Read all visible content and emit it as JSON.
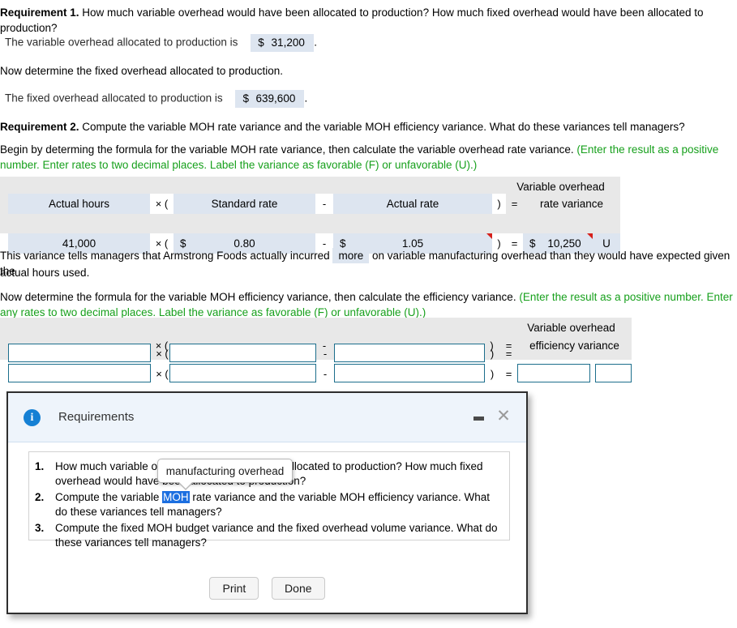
{
  "req1": {
    "label": "Requirement 1.",
    "question": "How much variable overhead would have been allocated to production? How much fixed overhead would have been allocated to production?",
    "line1_prefix": "The variable overhead allocated to production is",
    "line1_currency": "$",
    "line1_value": "31,200",
    "line1_suffix": ".",
    "line2": "Now determine the fixed overhead allocated to production.",
    "line3_prefix": "The fixed overhead allocated to production is",
    "line3_currency": "$",
    "line3_value": "639,600",
    "line3_suffix": "."
  },
  "req2": {
    "label": "Requirement 2.",
    "question": "Compute the variable MOH rate variance and the variable MOH efficiency variance. What do these variances tell managers?",
    "instruction_black": "Begin by determing the formula for the variable MOH rate variance, then calculate the variable overhead rate variance.",
    "instruction_green": "(Enter the result as a positive number. Enter rates to two decimal places. Label the variance as favorable (F) or unfavorable (U).)"
  },
  "rate_table": {
    "header_top_right": "Variable overhead",
    "headers": {
      "col1": "Actual hours",
      "op1": "× (",
      "col2": "Standard rate",
      "op2": "-",
      "col3": "Actual rate",
      "op3": ")",
      "eq": "=",
      "result": "rate variance"
    },
    "values": {
      "col1": "41,000",
      "op1": "× (",
      "col2_currency": "$",
      "col2": "0.80",
      "op2": "-",
      "col3_currency": "$",
      "col3": "1.05",
      "op3": ")",
      "eq": "=",
      "result_currency": "$",
      "result": "10,250",
      "flag": "U"
    }
  },
  "narrative": {
    "prefix": "This variance tells managers that Armstrong Foods actually incurred",
    "dropdown_value": "more",
    "suffix": "on variable manufacturing overhead than they would have expected given the",
    "line2": "actual hours used."
  },
  "req2b": {
    "instruction_black": "Now determine the formula for the variable MOH efficiency variance, then calculate the efficiency variance.",
    "instruction_green": "(Enter the result as a positive number. Enter any rates to two decimal places. Label the variance as favorable (F) or unfavorable (U).)"
  },
  "efficiency_table": {
    "header_top_right": "Variable overhead",
    "headers": {
      "op1": "× (",
      "op2": "-",
      "op3": ")",
      "eq": "=",
      "result": "efficiency variance"
    },
    "values": {
      "op1": "× (",
      "op2": "-",
      "op3": ")",
      "eq": "="
    },
    "inputs": {
      "r1c1": "",
      "r1c2": "",
      "r1c3": "",
      "r2c1": "",
      "r2c2": "",
      "r2c3": "",
      "r2result": "",
      "r2flag": ""
    },
    "placeholder": ""
  },
  "dialog": {
    "title": "Requirements",
    "info_icon": "info-icon",
    "minimize_icon": "minimize-icon",
    "close_icon": "close-icon",
    "items": [
      {
        "num": "1.",
        "text": "How much variable overhead would have been allocated to production? How much fixed overhead would have been allocated to production?"
      },
      {
        "num": "2.",
        "pre": "Compute the variable ",
        "sel": "MOH",
        "post": " rate variance and the variable MOH efficiency variance. What do these variances tell managers?"
      },
      {
        "num": "3.",
        "text": "Compute the fixed MOH budget variance and the fixed overhead volume variance. What do these variances tell managers?"
      }
    ],
    "tooltip": "manufacturing overhead",
    "print_label": "Print",
    "done_label": "Done"
  },
  "colors": {
    "green": "#17a01c",
    "cell_blue": "#dde5f0",
    "table_gray": "#e8e8e8",
    "input_border": "#1c6e8c",
    "accent_blue": "#1580d4",
    "selection_blue": "#1c6fe0",
    "flag_red": "#d6201b"
  }
}
